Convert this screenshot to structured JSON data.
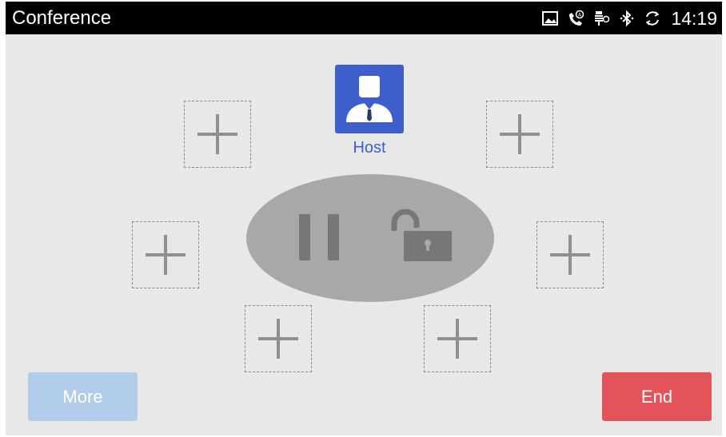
{
  "statusbar": {
    "title": "Conference",
    "time": "14:19",
    "icons": [
      "gallery-icon",
      "call-auto-answer-icon",
      "usb-debug-icon",
      "bluetooth-icon",
      "sync-icon"
    ]
  },
  "host": {
    "label": "Host",
    "icon": "person-icon"
  },
  "participant_slots": [
    "add-participant",
    "add-participant",
    "add-participant",
    "add-participant",
    "add-participant",
    "add-participant"
  ],
  "controls": {
    "pause_icon": "pause-icon",
    "lock_icon": "unlocked-padlock-icon"
  },
  "buttons": {
    "more": "More",
    "end": "End"
  },
  "colors": {
    "background": "#e8e8e8",
    "statusbar": "#000000",
    "host_accent": "#3e5ecc",
    "more_button": "#b1cde9",
    "end_button": "#e2545a",
    "control_ellipse": "#a8a8a8",
    "control_icon": "#777777"
  }
}
